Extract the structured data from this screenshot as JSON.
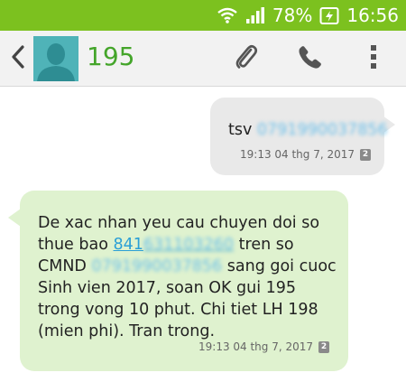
{
  "status_bar": {
    "battery_text": "78%",
    "time": "16:56",
    "icons": [
      "wifi-icon",
      "signal-icon",
      "battery-charging-icon"
    ]
  },
  "header": {
    "contact_name": "195",
    "actions": [
      "attach-icon",
      "call-icon",
      "more-icon"
    ]
  },
  "messages": {
    "outgoing": {
      "text_prefix": "tsv ",
      "redacted_number": "0791990037856",
      "timestamp": "19:13 04 thg 7, 2017",
      "sim": "2"
    },
    "incoming": {
      "line1": "De xac nhan yeu cau chuyen doi so",
      "line2_prefix": "thue bao ",
      "line2_link": "841",
      "line2_link_redacted": "631103260",
      "line2_suffix": " tren so",
      "line3_prefix": "CMND ",
      "line3_redacted": "0791990037856",
      "line3_suffix": " sang goi cuoc",
      "line4": "Sinh vien 2017, soan OK gui 195",
      "line5": "trong vong 10 phut. Chi tiet LH 198",
      "line6": "(mien phi). Tran trong.",
      "timestamp": "19:13 04 thg 7, 2017",
      "sim": "2"
    }
  },
  "colors": {
    "status_bar": "#7cc11f",
    "contact_name": "#44a52a",
    "incoming_bubble": "#dff2cf",
    "outgoing_bubble": "#e9e9e9",
    "link": "#2a9fd6"
  }
}
